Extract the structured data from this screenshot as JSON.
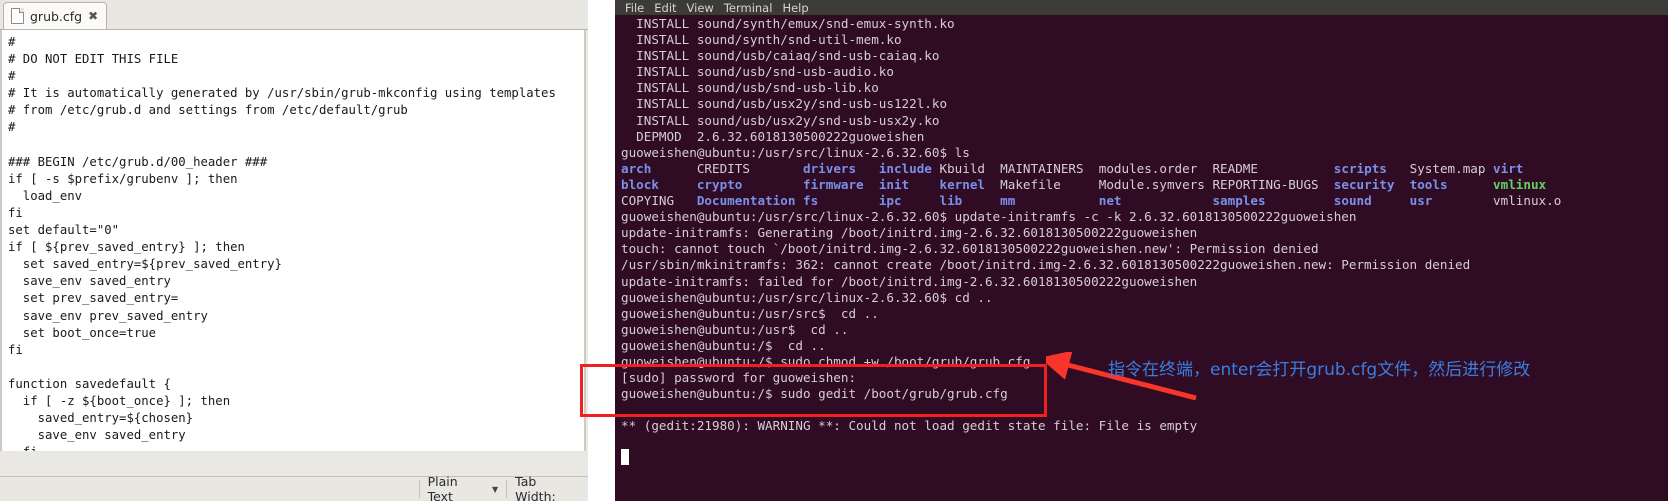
{
  "gedit": {
    "tab": {
      "label": "grub.cfg",
      "close_glyph": "✖",
      "icon": "document-icon"
    },
    "content": "#\n# DO NOT EDIT THIS FILE\n#\n# It is automatically generated by /usr/sbin/grub-mkconfig using templates\n# from /etc/grub.d and settings from /etc/default/grub\n#\n\n### BEGIN /etc/grub.d/00_header ###\nif [ -s $prefix/grubenv ]; then\n  load_env\nfi\nset default=\"0\"\nif [ ${prev_saved_entry} ]; then\n  set saved_entry=${prev_saved_entry}\n  save_env saved_entry\n  set prev_saved_entry=\n  save_env prev_saved_entry\n  set boot_once=true\nfi\n\nfunction savedefault {\n  if [ -z ${boot_once} ]; then\n    saved_entry=${chosen}\n    save_env saved_entry\n  fi\n}",
    "statusbar": {
      "language": "Plain Text",
      "tab_width_label": "Tab Width:",
      "dropdown_glyph": "▼"
    }
  },
  "terminal": {
    "menu": [
      "File",
      "Edit",
      "View",
      "Terminal",
      "Help"
    ],
    "prompt_cwd_src": "guoweishen@ubuntu:/usr/src/linux-2.6.32.60$",
    "lines": [
      "  INSTALL sound/synth/emux/snd-emux-synth.ko",
      "  INSTALL sound/synth/snd-util-mem.ko",
      "  INSTALL sound/usb/caiaq/snd-usb-caiaq.ko",
      "  INSTALL sound/usb/snd-usb-audio.ko",
      "  INSTALL sound/usb/snd-usb-lib.ko",
      "  INSTALL sound/usb/usx2y/snd-usb-us122l.ko",
      "  INSTALL sound/usb/usx2y/snd-usb-usx2y.ko",
      "  DEPMOD  2.6.32.6018130500222guoweishen",
      "guoweishen@ubuntu:/usr/src/linux-2.6.32.60$ ls",
      "guoweishen@ubuntu:/usr/src/linux-2.6.32.60$ update-initramfs -c -k 2.6.32.6018130500222guoweishen",
      "update-initramfs: Generating /boot/initrd.img-2.6.32.6018130500222guoweishen",
      "touch: cannot touch `/boot/initrd.img-2.6.32.6018130500222guoweishen.new': Permission denied",
      "/usr/sbin/mkinitramfs: 362: cannot create /boot/initrd.img-2.6.32.6018130500222guoweishen.new: Permission denied",
      "update-initramfs: failed for /boot/initrd.img-2.6.32.6018130500222guoweishen",
      "guoweishen@ubuntu:/usr/src/linux-2.6.32.60$ cd ..",
      "guoweishen@ubuntu:/usr/src$  cd ..",
      "guoweishen@ubuntu:/usr$  cd ..",
      "guoweishen@ubuntu:/$  cd ..",
      "guoweishen@ubuntu:/$ sudo chmod +w /boot/grub/grub.cfg",
      "[sudo] password for guoweishen:",
      "guoweishen@ubuntu:/$ sudo gedit /boot/grub/grub.cfg",
      "",
      "** (gedit:21980): WARNING **: Could not load gedit state file: File is empty"
    ],
    "ls_output": {
      "columns": [
        [
          "arch",
          "block",
          "COPYING"
        ],
        [
          "CREDITS",
          "crypto",
          "Documentation"
        ],
        [
          "drivers",
          "firmware",
          "fs"
        ],
        [
          "include",
          "init",
          "ipc"
        ],
        [
          "Kbuild",
          "kernel",
          "lib"
        ],
        [
          "MAINTAINERS",
          "Makefile",
          "mm"
        ],
        [
          "modules.order",
          "Module.symvers",
          "net"
        ],
        [
          "README",
          "REPORTING-BUGS",
          "samples"
        ],
        [
          "scripts",
          "security",
          "sound"
        ],
        [
          "System.map",
          "tools",
          "usr"
        ],
        [
          "virt",
          "vmlinux",
          "vmlinux.o"
        ]
      ],
      "types": [
        [
          "dir",
          "dir",
          "file"
        ],
        [
          "file",
          "dir",
          "dir"
        ],
        [
          "dir",
          "dir",
          "dir"
        ],
        [
          "dir",
          "dir",
          "dir"
        ],
        [
          "file",
          "dir",
          "dir"
        ],
        [
          "file",
          "file",
          "dir"
        ],
        [
          "file",
          "file",
          "dir"
        ],
        [
          "file",
          "file",
          "dir"
        ],
        [
          "dir",
          "dir",
          "dir"
        ],
        [
          "file",
          "dir",
          "dir"
        ],
        [
          "dir",
          "exec",
          "file"
        ]
      ]
    }
  },
  "annotation": {
    "text": "指令在终端，enter会打开grub.cfg文件，然后进行修改",
    "box_color": "#f02020",
    "arrow_color": "#f8342b",
    "text_color": "#3b7fe0"
  }
}
